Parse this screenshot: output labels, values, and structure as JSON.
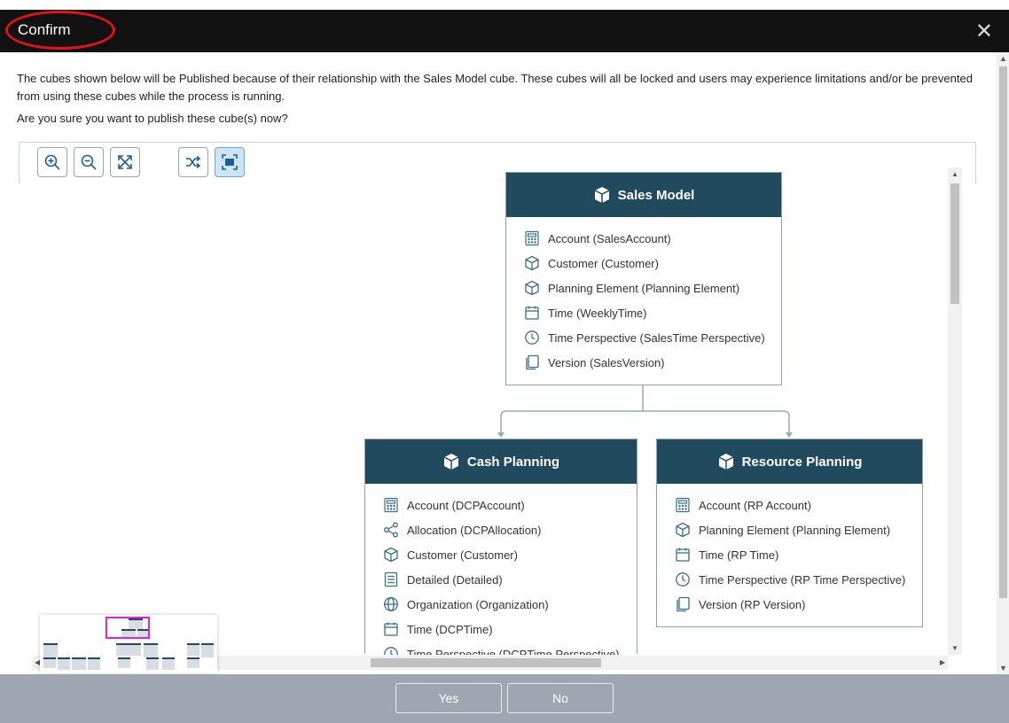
{
  "dialog": {
    "title": "Confirm",
    "close_glyph": "✕",
    "message_line1": "The cubes shown below will be Published because of their relationship with the Sales Model cube. These cubes will all be locked and users may experience limitations and/or be prevented from using these cubes while the process is running.",
    "message_line2": "Are you sure you want to publish these cube(s) now?"
  },
  "toolbar": {
    "buttons": [
      {
        "name": "zoom-in-button",
        "icon": "zoom-in-icon"
      },
      {
        "name": "zoom-out-button",
        "icon": "zoom-out-icon"
      },
      {
        "name": "fit-to-screen-button",
        "icon": "expand-arrows-icon"
      },
      {
        "name": "shuffle-layout-button",
        "icon": "shuffle-icon"
      },
      {
        "name": "focus-frame-button",
        "icon": "focus-frame-icon",
        "active": true
      }
    ]
  },
  "cubes": {
    "sales_model": {
      "title": "Sales Model",
      "rows": [
        {
          "label": "Account (SalesAccount)",
          "icon": "calculator-icon"
        },
        {
          "label": "Customer (Customer)",
          "icon": "cube-outline-icon"
        },
        {
          "label": "Planning Element (Planning Element)",
          "icon": "cube-outline-icon"
        },
        {
          "label": "Time (WeeklyTime)",
          "icon": "calendar-icon"
        },
        {
          "label": "Time Perspective (SalesTime Perspective)",
          "icon": "clock-icon"
        },
        {
          "label": "Version (SalesVersion)",
          "icon": "copy-pages-icon"
        }
      ]
    },
    "cash_planning": {
      "title": "Cash Planning",
      "rows": [
        {
          "label": "Account (DCPAccount)",
          "icon": "calculator-icon"
        },
        {
          "label": "Allocation (DCPAllocation)",
          "icon": "share-nodes-icon"
        },
        {
          "label": "Customer (Customer)",
          "icon": "cube-outline-icon"
        },
        {
          "label": "Detailed (Detailed)",
          "icon": "list-document-icon"
        },
        {
          "label": "Organization (Organization)",
          "icon": "globe-icon"
        },
        {
          "label": "Time (DCPTime)",
          "icon": "calendar-icon"
        },
        {
          "label": "Time Perspective (DCPTime Perspective)",
          "icon": "clock-icon"
        }
      ]
    },
    "resource_planning": {
      "title": "Resource Planning",
      "rows": [
        {
          "label": "Account (RP Account)",
          "icon": "calculator-icon"
        },
        {
          "label": "Planning Element (Planning Element)",
          "icon": "cube-outline-icon"
        },
        {
          "label": "Time (RP Time)",
          "icon": "calendar-icon"
        },
        {
          "label": "Time Perspective (RP Time Perspective)",
          "icon": "clock-icon"
        },
        {
          "label": "Version (RP Version)",
          "icon": "copy-pages-icon"
        }
      ]
    }
  },
  "footer": {
    "yes_label": "Yes",
    "no_label": "No"
  },
  "colors": {
    "titlebar": "#121212",
    "cube_header": "#214a5e",
    "footer": "#9fa5b1",
    "highlight_ring": "#e0121a",
    "minimap_viewport": "#e021e0"
  }
}
